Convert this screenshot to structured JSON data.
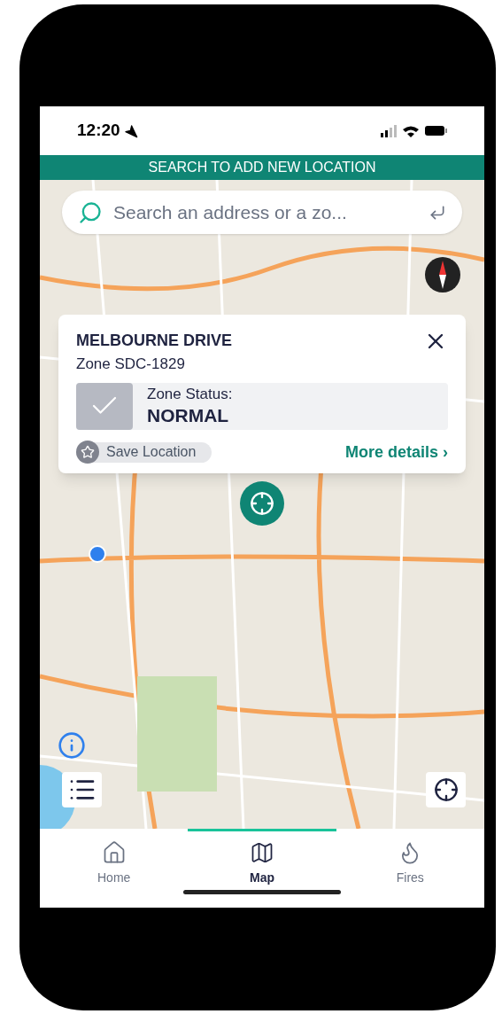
{
  "status_bar": {
    "time": "12:20"
  },
  "banner": {
    "text": "SEARCH TO ADD NEW LOCATION"
  },
  "search": {
    "placeholder": "Search an address or a zo..."
  },
  "zone_card": {
    "title": "MELBOURNE DRIVE",
    "subtitle": "Zone SDC-1829",
    "status_label": "Zone Status:",
    "status": "NORMAL",
    "save_label": "Save Location",
    "saved": false,
    "details_link": "More details ›"
  },
  "tabs": [
    {
      "label": "Home",
      "kind": "home",
      "selected": false
    },
    {
      "label": "Map",
      "kind": "map",
      "selected": true
    },
    {
      "label": "Fires",
      "kind": "fires",
      "selected": false
    }
  ]
}
